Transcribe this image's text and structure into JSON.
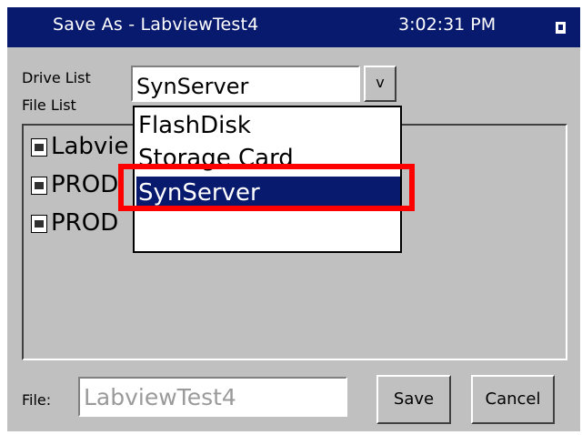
{
  "window": {
    "title": "Save As - LabviewTest4",
    "clock": "3:02:31 PM"
  },
  "drive": {
    "label": "Drive List",
    "selected": "SynServer",
    "dropdown_button": "v",
    "options": [
      "FlashDisk",
      "Storage Card",
      "SynServer"
    ],
    "highlighted_option": "SynServer"
  },
  "file_list": {
    "label": "File List",
    "items": [
      "Labvie",
      "PROD",
      "PROD"
    ]
  },
  "file": {
    "label": "File:",
    "value": "LabviewTest4"
  },
  "buttons": {
    "save": "Save",
    "cancel": "Cancel"
  },
  "colors": {
    "titlebar": "#081a6e",
    "selection": "#081a6e",
    "annotation_box": "#ff0000"
  }
}
